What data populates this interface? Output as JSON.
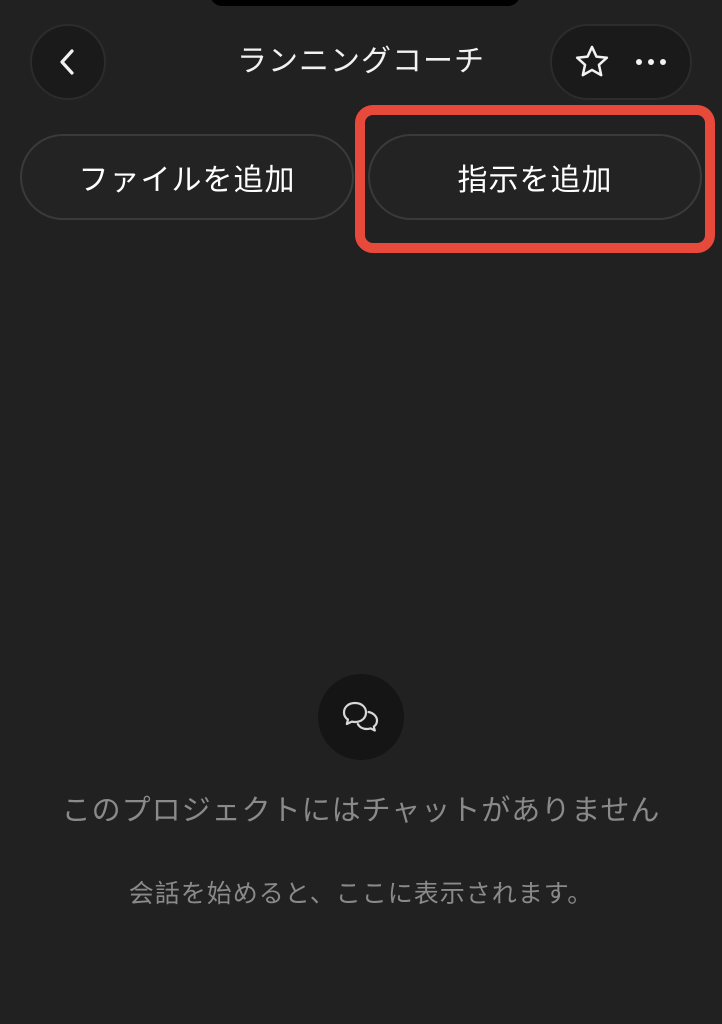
{
  "header": {
    "title": "ランニングコーチ",
    "back_icon": "chevron-left-icon",
    "favorite_icon": "star-icon",
    "more_icon": "ellipsis-icon"
  },
  "actions": {
    "add_file_label": "ファイルを追加",
    "add_instruction_label": "指示を追加"
  },
  "empty_state": {
    "icon": "chat-bubbles-icon",
    "title": "このプロジェクトにはチャットがありません",
    "subtitle": "会話を始めると、ここに表示されます。"
  },
  "colors": {
    "background": "#212121",
    "highlight": "#e74a3b",
    "muted_text": "#8a8a8a"
  }
}
